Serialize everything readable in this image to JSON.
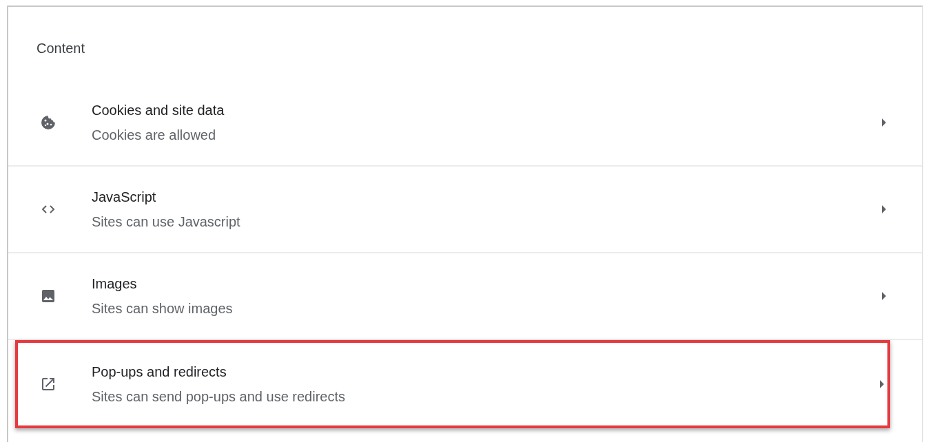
{
  "section": {
    "title": "Content"
  },
  "items": [
    {
      "kind": "cookie",
      "title": "Cookies and site data",
      "subtitle": "Cookies are allowed",
      "highlighted": false
    },
    {
      "kind": "code",
      "title": "JavaScript",
      "subtitle": "Sites can use Javascript",
      "highlighted": false
    },
    {
      "kind": "image",
      "title": "Images",
      "subtitle": "Sites can show images",
      "highlighted": false
    },
    {
      "kind": "popup",
      "title": "Pop-ups and redirects",
      "subtitle": "Sites can send pop-ups and use redirects",
      "highlighted": true
    }
  ]
}
